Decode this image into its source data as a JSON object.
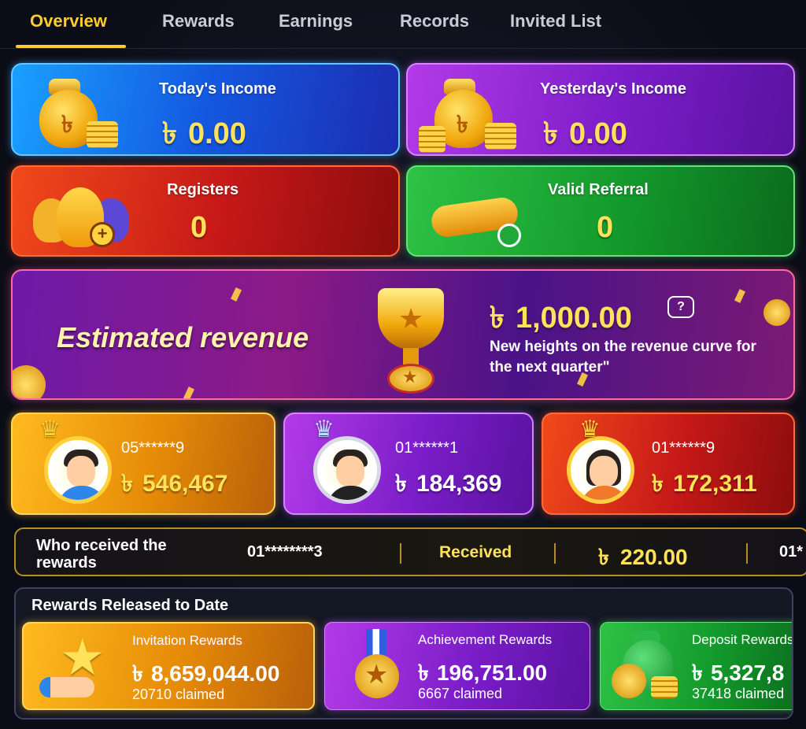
{
  "tabs": [
    "Overview",
    "Rewards",
    "Earnings",
    "Records",
    "Invited List"
  ],
  "currency": "৳",
  "stats": {
    "today": {
      "label": "Today's Income",
      "value": "0.00"
    },
    "yesterday": {
      "label": "Yesterday's Income",
      "value": "0.00"
    },
    "registers": {
      "label": "Registers",
      "value": "0"
    },
    "valid_referral": {
      "label": "Valid Referral",
      "value": "0"
    }
  },
  "banner": {
    "title": "Estimated revenue",
    "amount": "1,000.00",
    "help_icon": "?",
    "text_line1": "New heights on the revenue curve for",
    "text_line2": "the next quarter\""
  },
  "top_earners": [
    {
      "masked_id": "05******9",
      "amount": "546,467",
      "color": "gold"
    },
    {
      "masked_id": "01******1",
      "amount": "184,369",
      "color": "purple"
    },
    {
      "masked_id": "01******9",
      "amount": "172,311",
      "color": "red"
    }
  ],
  "received_strip": {
    "label_line1": "Who received the",
    "label_line2": "rewards",
    "masked_id": "01********3",
    "status": "Received",
    "amount": "220.00",
    "next_masked_id": "01*"
  },
  "released": {
    "title": "Rewards Released to Date",
    "items": [
      {
        "label": "Invitation Rewards",
        "amount": "8,659,044.00",
        "claimed": "20710 claimed"
      },
      {
        "label": "Achievement Rewards",
        "amount": "196,751.00",
        "claimed": "6667 claimed"
      },
      {
        "label": "Deposit Rewards",
        "amount": "5,327,8",
        "claimed": "37418 claimed"
      }
    ]
  }
}
